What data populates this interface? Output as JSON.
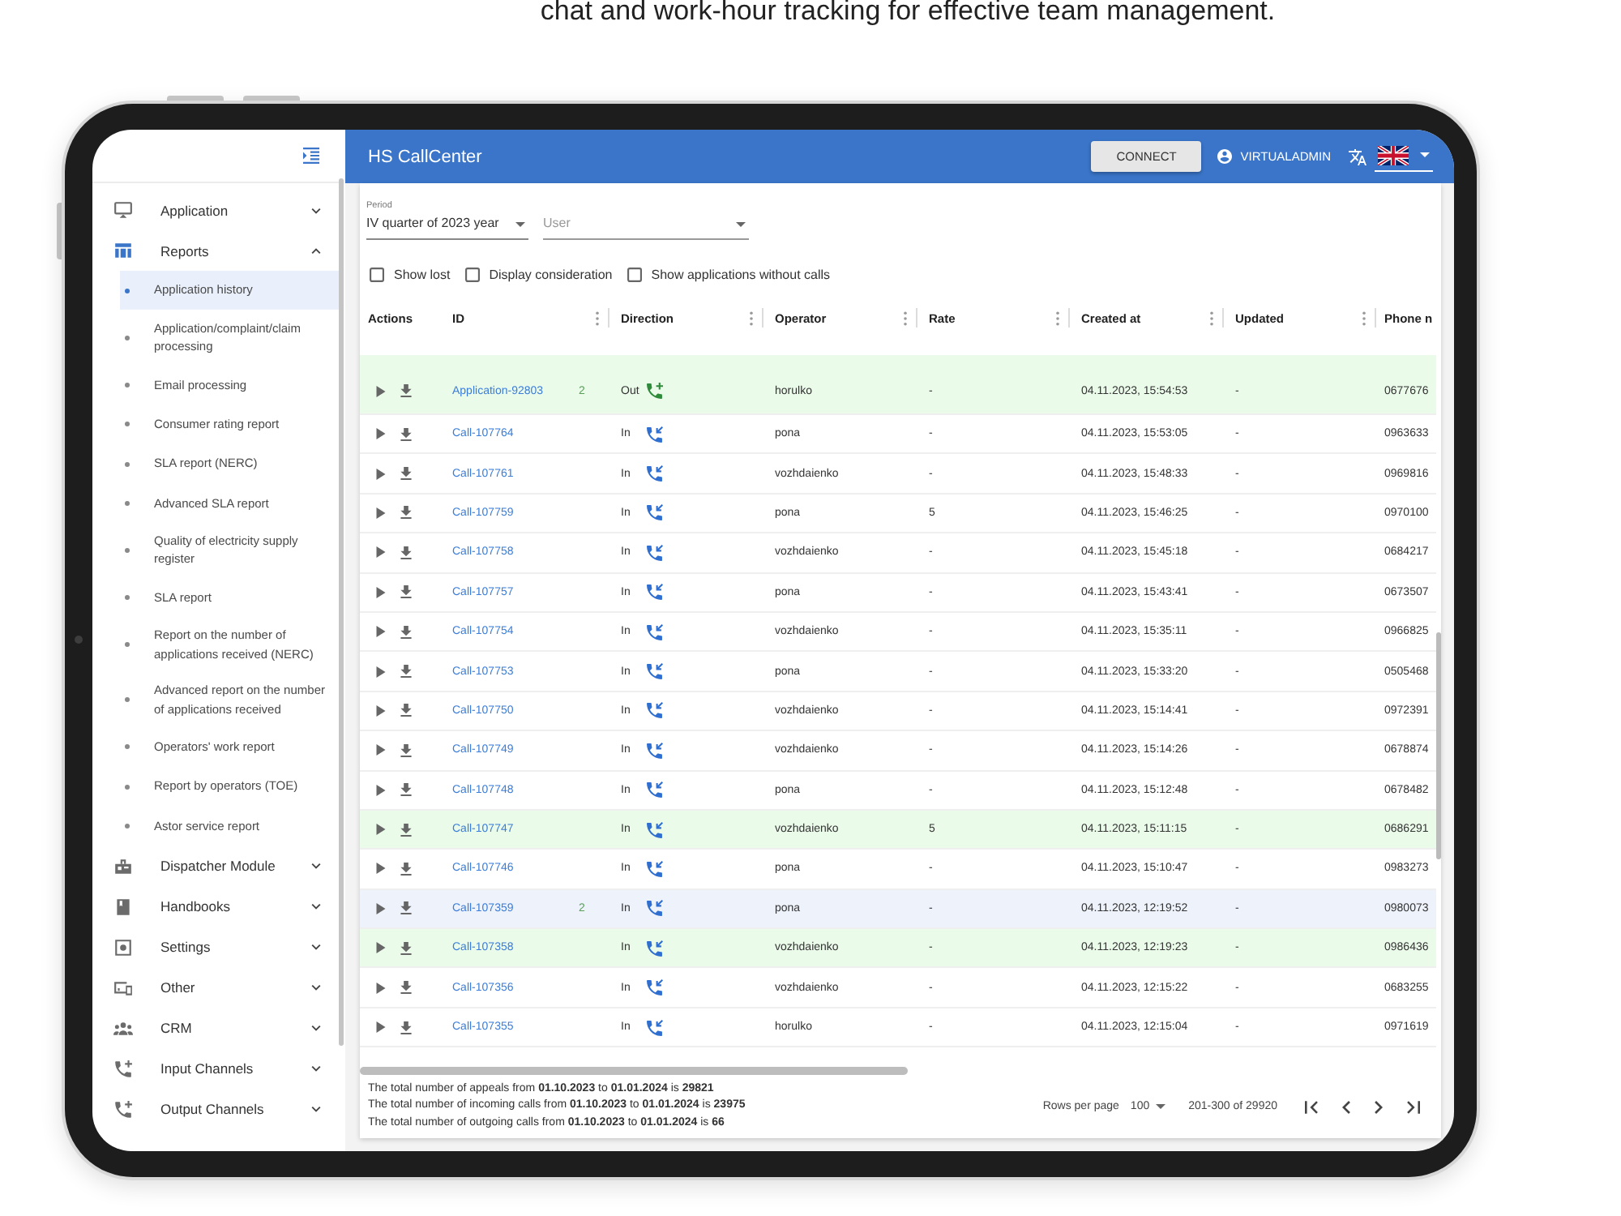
{
  "page": {
    "tagline": "chat and work-hour tracking for effective team management."
  },
  "sidebar": {
    "items": [
      {
        "label": "Application",
        "selected": false,
        "expanded": false
      },
      {
        "label": "Reports",
        "selected": true,
        "expanded": true,
        "children": [
          {
            "label": "Application history",
            "selected": true
          },
          {
            "label": "Application/complaint/claim processing",
            "selected": false
          },
          {
            "label": "Email processing",
            "selected": false
          },
          {
            "label": "Consumer rating report",
            "selected": false
          },
          {
            "label": "SLA report (NERC)",
            "selected": false
          },
          {
            "label": "Advanced SLA report",
            "selected": false
          },
          {
            "label": "Quality of electricity supply register",
            "selected": false
          },
          {
            "label": "SLA report",
            "selected": false
          },
          {
            "label": "Report on the number of applications received (NERC)",
            "selected": false
          },
          {
            "label": "Advanced report on the number of applications received",
            "selected": false
          },
          {
            "label": "Operators' work report",
            "selected": false
          },
          {
            "label": "Report by operators (TOE)",
            "selected": false
          },
          {
            "label": "Astor service report",
            "selected": false
          }
        ]
      },
      {
        "label": "Dispatcher Module",
        "selected": false,
        "expanded": false
      },
      {
        "label": "Handbooks",
        "selected": false,
        "expanded": false
      },
      {
        "label": "Settings",
        "selected": false,
        "expanded": false
      },
      {
        "label": "Other",
        "selected": false,
        "expanded": false
      },
      {
        "label": "CRM",
        "selected": false,
        "expanded": false
      },
      {
        "label": "Input Channels",
        "selected": false,
        "expanded": false
      },
      {
        "label": "Output Channels",
        "selected": false,
        "expanded": false
      }
    ]
  },
  "header": {
    "title": "HS CallCenter",
    "connect_button": "CONNECT",
    "user": "VIRTUALADMIN"
  },
  "filters": {
    "period": {
      "label": "Period",
      "value": "IV quarter of 2023 year"
    },
    "user": {
      "placeholder": "User"
    },
    "checkboxes": [
      {
        "label": "Show lost",
        "checked": false
      },
      {
        "label": "Display consideration",
        "checked": false
      },
      {
        "label": "Show applications without calls",
        "checked": false
      }
    ]
  },
  "table": {
    "columns": [
      {
        "label": "Actions",
        "menu": false
      },
      {
        "label": "ID",
        "menu": true
      },
      {
        "label": "Direction",
        "menu": true
      },
      {
        "label": "Operator",
        "menu": true
      },
      {
        "label": "Rate",
        "menu": true
      },
      {
        "label": "Created at",
        "menu": true
      },
      {
        "label": "Updated",
        "menu": true
      },
      {
        "label": "Phone n",
        "menu": false
      }
    ],
    "rows": [
      {
        "id": "Application-92803",
        "count": "2",
        "direction": "Out",
        "kind": "outgoing",
        "operator": "horulko",
        "rate": "-",
        "created_at": "04.11.2023, 15:54:53",
        "updated": "-",
        "phone": "0677676",
        "color": "#ebfbea"
      },
      {
        "id": "Call-107764",
        "direction": "In",
        "kind": "incoming",
        "operator": "pona",
        "rate": "-",
        "created_at": "04.11.2023, 15:53:05",
        "updated": "-",
        "phone": "0963633",
        "color": "#ffffff"
      },
      {
        "id": "Call-107761",
        "direction": "In",
        "kind": "incoming",
        "operator": "vozhdaienko",
        "rate": "-",
        "created_at": "04.11.2023, 15:48:33",
        "updated": "-",
        "phone": "0969816",
        "color": "#ffffff"
      },
      {
        "id": "Call-107759",
        "direction": "In",
        "kind": "incoming",
        "operator": "pona",
        "rate": "5",
        "created_at": "04.11.2023, 15:46:25",
        "updated": "-",
        "phone": "0970100",
        "color": "#ffffff"
      },
      {
        "id": "Call-107758",
        "direction": "In",
        "kind": "incoming",
        "operator": "vozhdaienko",
        "rate": "-",
        "created_at": "04.11.2023, 15:45:18",
        "updated": "-",
        "phone": "0684217",
        "color": "#ffffff"
      },
      {
        "id": "Call-107757",
        "direction": "In",
        "kind": "incoming",
        "operator": "pona",
        "rate": "-",
        "created_at": "04.11.2023, 15:43:41",
        "updated": "-",
        "phone": "0673507",
        "color": "#ffffff"
      },
      {
        "id": "Call-107754",
        "direction": "In",
        "kind": "incoming",
        "operator": "vozhdaienko",
        "rate": "-",
        "created_at": "04.11.2023, 15:35:11",
        "updated": "-",
        "phone": "0966825",
        "color": "#ffffff"
      },
      {
        "id": "Call-107753",
        "direction": "In",
        "kind": "incoming",
        "operator": "pona",
        "rate": "-",
        "created_at": "04.11.2023, 15:33:20",
        "updated": "-",
        "phone": "0505468",
        "color": "#ffffff"
      },
      {
        "id": "Call-107750",
        "direction": "In",
        "kind": "incoming",
        "operator": "vozhdaienko",
        "rate": "-",
        "created_at": "04.11.2023, 15:14:41",
        "updated": "-",
        "phone": "0972391",
        "color": "#ffffff"
      },
      {
        "id": "Call-107749",
        "direction": "In",
        "kind": "incoming",
        "operator": "vozhdaienko",
        "rate": "-",
        "created_at": "04.11.2023, 15:14:26",
        "updated": "-",
        "phone": "0678874",
        "color": "#ffffff"
      },
      {
        "id": "Call-107748",
        "direction": "In",
        "kind": "incoming",
        "operator": "pona",
        "rate": "-",
        "created_at": "04.11.2023, 15:12:48",
        "updated": "-",
        "phone": "0678482",
        "color": "#ffffff"
      },
      {
        "id": "Call-107747",
        "direction": "In",
        "kind": "incoming",
        "operator": "vozhdaienko",
        "rate": "5",
        "created_at": "04.11.2023, 15:11:15",
        "updated": "-",
        "phone": "0686291",
        "color": "#ebfbea"
      },
      {
        "id": "Call-107746",
        "direction": "In",
        "kind": "incoming",
        "operator": "pona",
        "rate": "-",
        "created_at": "04.11.2023, 15:10:47",
        "updated": "-",
        "phone": "0983273",
        "color": "#ffffff"
      },
      {
        "id": "Call-107359",
        "count": "2",
        "direction": "In",
        "kind": "incoming",
        "operator": "pona",
        "rate": "-",
        "created_at": "04.11.2023, 12:19:52",
        "updated": "-",
        "phone": "0980073",
        "color": "#eef2fb"
      },
      {
        "id": "Call-107358",
        "direction": "In",
        "kind": "incoming",
        "operator": "vozhdaienko",
        "rate": "-",
        "created_at": "04.11.2023, 12:19:23",
        "updated": "-",
        "phone": "0986436",
        "color": "#ebfbea"
      },
      {
        "id": "Call-107356",
        "direction": "In",
        "kind": "incoming",
        "operator": "vozhdaienko",
        "rate": "-",
        "created_at": "04.11.2023, 12:15:22",
        "updated": "-",
        "phone": "0683255",
        "color": "#ffffff"
      },
      {
        "id": "Call-107355",
        "direction": "In",
        "kind": "incoming",
        "operator": "horulko",
        "rate": "-",
        "created_at": "04.11.2023, 12:15:04",
        "updated": "-",
        "phone": "0971619",
        "color": "#ffffff"
      }
    ]
  },
  "footer": {
    "totals": [
      "The total number of appeals from **01.10.2023** to **01.01.2024** is **29821**",
      "The total number of incoming calls from **01.10.2023** to **01.01.2024** is **23975**",
      "The total number of outgoing calls from **01.10.2023** to **01.01.2024** is **66**"
    ],
    "rows_per_page_label": "Rows per page",
    "rows_per_page": "100",
    "range": "201-300 of 29920"
  }
}
